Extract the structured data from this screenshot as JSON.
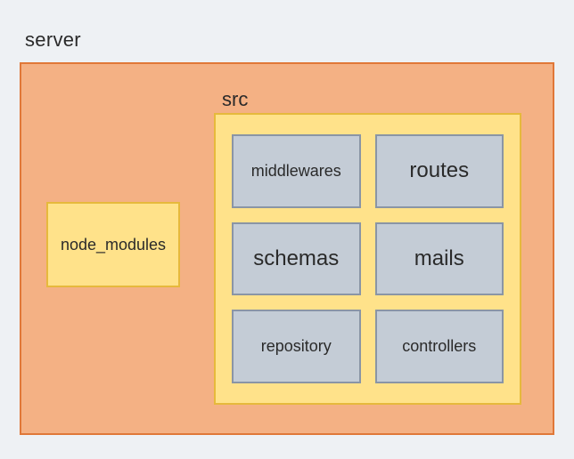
{
  "server": {
    "label": "server",
    "node_modules_label": "node_modules",
    "src": {
      "label": "src",
      "items": [
        {
          "label": "middlewares",
          "size": "small"
        },
        {
          "label": "routes",
          "size": "large"
        },
        {
          "label": "schemas",
          "size": "large"
        },
        {
          "label": "mails",
          "size": "large"
        },
        {
          "label": "repository",
          "size": "small"
        },
        {
          "label": "controllers",
          "size": "small"
        }
      ]
    }
  }
}
